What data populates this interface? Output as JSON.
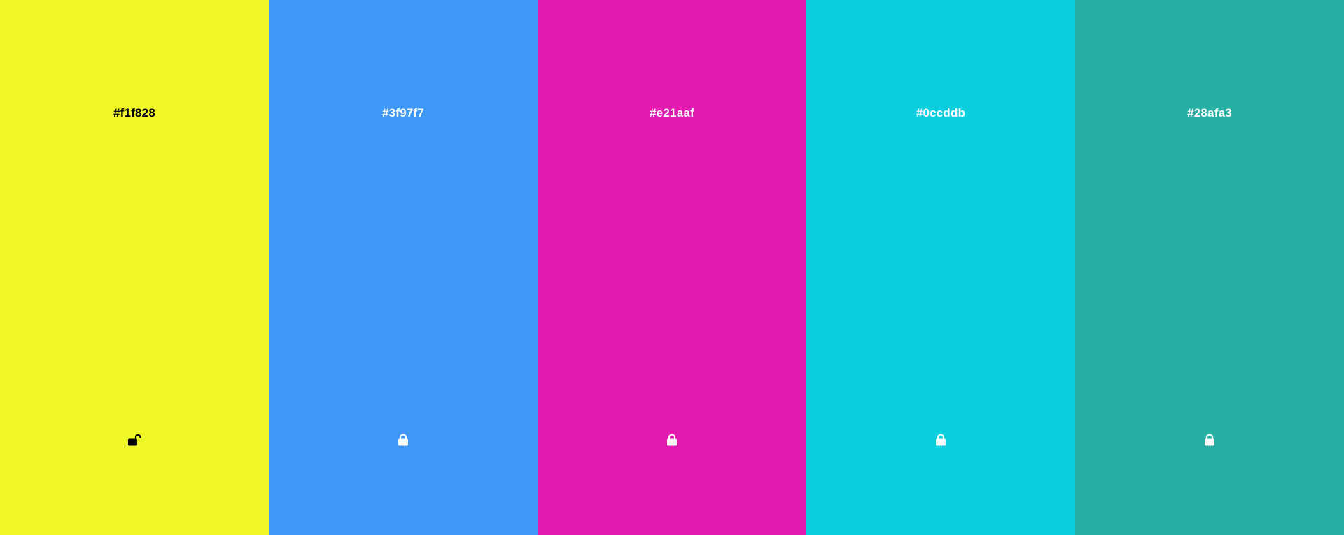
{
  "swatches": [
    {
      "hex": "#f1f828",
      "text_color": "#000000",
      "locked": false,
      "icon": "lock-open-icon"
    },
    {
      "hex": "#3f97f7",
      "text_color": "#ffffff",
      "locked": true,
      "icon": "lock-closed-icon"
    },
    {
      "hex": "#e21aaf",
      "text_color": "#ffffff",
      "locked": true,
      "icon": "lock-closed-icon"
    },
    {
      "hex": "#0ccddb",
      "text_color": "#ffffff",
      "locked": true,
      "icon": "lock-closed-icon"
    },
    {
      "hex": "#28afa3",
      "text_color": "#ffffff",
      "locked": true,
      "icon": "lock-closed-icon"
    }
  ]
}
